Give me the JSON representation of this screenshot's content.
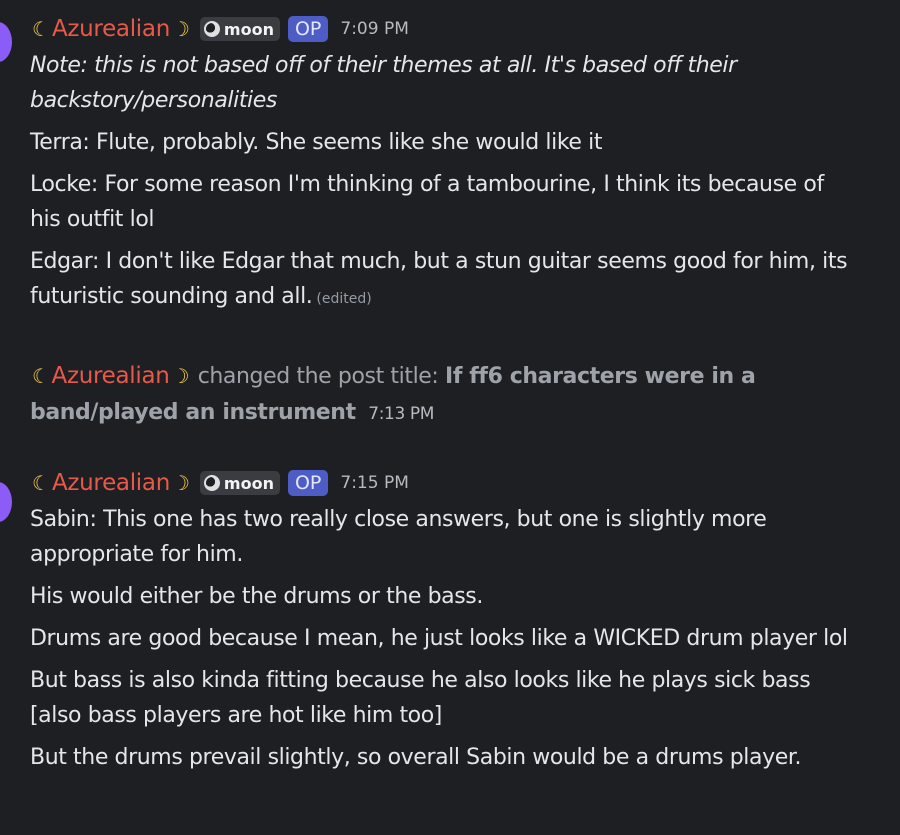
{
  "colors": {
    "background": "#1e1f22",
    "username": "#e8594a",
    "op_badge": "#4e5cc5",
    "avatar": "#8b5cf6"
  },
  "message1": {
    "author": "Azurealian",
    "moon_tag": "moon",
    "op_tag": "OP",
    "time": "7:09 PM",
    "lines": [
      "Note: this is not based off of their themes at all. It's based off their backstory/personalities",
      "Terra: Flute, probably. She seems like she would like it",
      "Locke: For some reason I'm thinking of a tambourine, I think its because of his outfit lol",
      "Edgar: I don't like Edgar that much, but a stun guitar seems good for him, its futuristic sounding and all."
    ],
    "edited_label": "(edited)"
  },
  "system": {
    "author": "Azurealian",
    "action": "changed the post title:",
    "title": "If ff6 characters were in a band/played an instrument",
    "time": "7:13 PM"
  },
  "message2": {
    "author": "Azurealian",
    "moon_tag": "moon",
    "op_tag": "OP",
    "time": "7:15 PM",
    "lines": [
      "Sabin: This one has two really close answers, but one is slightly more appropriate for him.",
      "His would either be the drums or the bass.",
      "Drums are good because I mean, he just looks like a WICKED drum player lol",
      "But bass is also kinda fitting because he also looks like he plays sick bass [also bass players are hot like him too]",
      "But the drums prevail slightly, so overall Sabin would be a drums player."
    ]
  }
}
